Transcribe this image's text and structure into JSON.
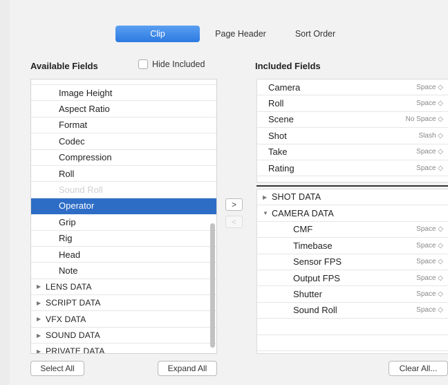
{
  "tabs": [
    {
      "label": "Clip",
      "active": true
    },
    {
      "label": "Page Header",
      "active": false
    },
    {
      "label": "Sort Order",
      "active": false
    }
  ],
  "available": {
    "heading": "Available Fields",
    "hide_included_label": "Hide Included",
    "fields": [
      "Image Height",
      "Aspect Ratio",
      "Format",
      "Codec",
      "Compression",
      "Roll",
      "Sound Roll",
      "Operator",
      "Grip",
      "Rig",
      "Head",
      "Note"
    ],
    "selected": "Operator",
    "groups": [
      "LENS DATA",
      "SCRIPT DATA",
      "VFX DATA",
      "SOUND DATA",
      "PRIVATE DATA"
    ]
  },
  "move_buttons": {
    "add": ">",
    "remove": "<"
  },
  "included": {
    "heading": "Included Fields",
    "fields": [
      {
        "name": "Camera",
        "separator": "Space ◇"
      },
      {
        "name": "Roll",
        "separator": "Space ◇"
      },
      {
        "name": "Scene",
        "separator": "No Space ◇"
      },
      {
        "name": "Shot",
        "separator": "Slash ◇"
      },
      {
        "name": "Take",
        "separator": "Space ◇"
      },
      {
        "name": "Rating",
        "separator": "Space ◇"
      }
    ],
    "categories": [
      {
        "name": "SHOT DATA",
        "expanded": false,
        "triangle": "▶"
      },
      {
        "name": "CAMERA DATA",
        "expanded": true,
        "triangle": "▼"
      }
    ],
    "camera_fields": [
      {
        "name": "CMF",
        "separator": "Space ◇"
      },
      {
        "name": "Timebase",
        "separator": "Space ◇"
      },
      {
        "name": "Sensor FPS",
        "separator": "Space ◇"
      },
      {
        "name": "Output FPS",
        "separator": "Space ◇"
      },
      {
        "name": "Shutter",
        "separator": "Space ◇"
      },
      {
        "name": "Sound Roll",
        "separator": "Space ◇"
      }
    ]
  },
  "buttons": {
    "select_all": "Select All",
    "expand_all": "Expand All",
    "clear_all": "Clear All..."
  },
  "colors": {
    "tab_active": "#2c79e0",
    "selection": "#2e6dc6"
  }
}
